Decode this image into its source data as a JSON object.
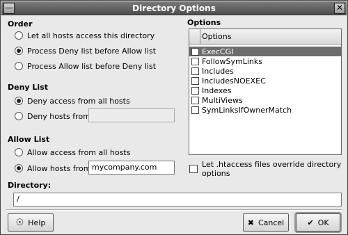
{
  "window": {
    "title": "Directory Options"
  },
  "order": {
    "title": "Order",
    "options": [
      {
        "label": "Let all hosts access this directory",
        "selected": false
      },
      {
        "label": "Process Deny list before Allow list",
        "selected": true
      },
      {
        "label": "Process Allow list before Deny list",
        "selected": false
      }
    ]
  },
  "deny": {
    "title": "Deny List",
    "all_label": "Deny access from all hosts",
    "from_label": "Deny hosts from:",
    "hosts_value": ""
  },
  "allow": {
    "title": "Allow List",
    "all_label": "Allow access from all hosts",
    "from_label": "Allow hosts from:",
    "hosts_value": "mycompany.com"
  },
  "options": {
    "title": "Options",
    "column_header": "Options",
    "items": [
      {
        "label": "ExecCGI",
        "checked": false,
        "selected": true
      },
      {
        "label": "FollowSymLinks",
        "checked": false,
        "selected": false
      },
      {
        "label": "Includes",
        "checked": false,
        "selected": false
      },
      {
        "label": "IncludesNOEXEC",
        "checked": false,
        "selected": false
      },
      {
        "label": "Indexes",
        "checked": false,
        "selected": false
      },
      {
        "label": "MultiViews",
        "checked": false,
        "selected": false
      },
      {
        "label": "SymLinksIfOwnerMatch",
        "checked": false,
        "selected": false
      }
    ],
    "htaccess_label": "Let .htaccess files override directory options"
  },
  "directory": {
    "title": "Directory:",
    "value": "/"
  },
  "buttons": {
    "help": "Help",
    "cancel": "Cancel",
    "ok": "OK"
  }
}
